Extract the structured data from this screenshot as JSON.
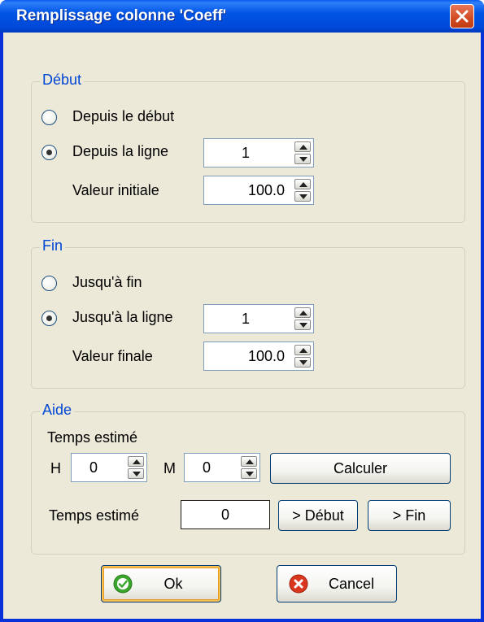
{
  "window": {
    "title": "Remplissage colonne 'Coeff'"
  },
  "debut": {
    "group_title": "Début",
    "radio_from_start": "Depuis le début",
    "radio_from_line": "Depuis la ligne",
    "selected": "from_line",
    "line_value": "1",
    "initial_label": "Valeur initiale",
    "initial_value": "100.0"
  },
  "fin": {
    "group_title": "Fin",
    "radio_to_end": "Jusqu'à fin",
    "radio_to_line": "Jusqu'à la ligne",
    "selected": "to_line",
    "line_value": "1",
    "final_label": "Valeur finale",
    "final_value": "100.0"
  },
  "aide": {
    "group_title": "Aide",
    "estimated_label": "Temps estimé",
    "hours_label": "H",
    "hours_value": "0",
    "minutes_label": "M",
    "minutes_value": "0",
    "calculate_button": "Calculer",
    "estimated_time_label": "Temps estimé",
    "estimated_time_value": "0",
    "to_start_button": "> Début",
    "to_end_button": "> Fin"
  },
  "buttons": {
    "ok": "Ok",
    "cancel": "Cancel"
  },
  "icons": {
    "close": "close-icon",
    "ok": "checkmark-icon",
    "cancel": "cancel-x-icon",
    "spin_up": "arrow-up-icon",
    "spin_down": "arrow-down-icon"
  },
  "colors": {
    "titlebar": "#0055e5",
    "group_title": "#0046d5",
    "close_button": "#d14a22",
    "ok_icon": "#3aa62e",
    "cancel_icon": "#d9381e"
  }
}
